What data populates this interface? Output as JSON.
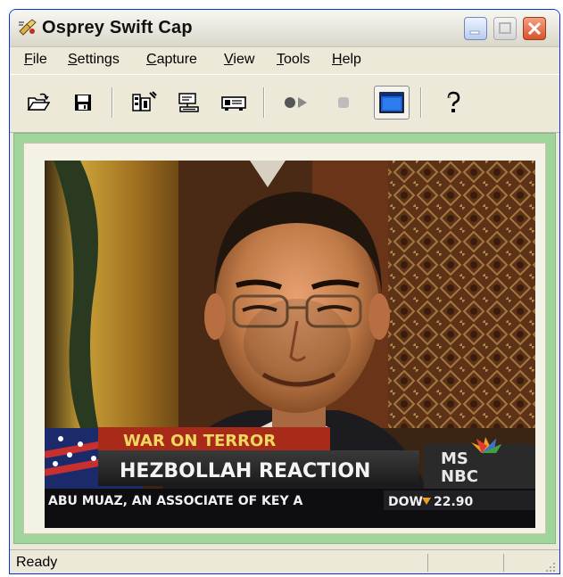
{
  "window": {
    "title": "Osprey Swift Cap"
  },
  "menu": {
    "items": [
      {
        "label": "File"
      },
      {
        "label": "Settings"
      },
      {
        "label": "Capture"
      },
      {
        "label": "View"
      },
      {
        "label": "Tools"
      },
      {
        "label": "Help"
      }
    ]
  },
  "toolbar": {
    "buttons": [
      {
        "icon": "open-folder-icon"
      },
      {
        "icon": "save-icon"
      },
      {
        "icon": "video-settings-icon"
      },
      {
        "icon": "capture-settings-icon"
      },
      {
        "icon": "device-icon"
      },
      {
        "icon": "record-icon"
      },
      {
        "icon": "stop-icon"
      },
      {
        "icon": "preview-window-icon"
      },
      {
        "icon": "help-icon"
      }
    ]
  },
  "video": {
    "lower_third_top": "WAR ON TERROR",
    "lower_third_main": "HEZBOLLAH REACTION",
    "ticker": "ABU MUAZ, AN ASSOCIATE OF KEY A",
    "dow_label": "DOW",
    "dow_value": "22.90",
    "network_line1": "MS",
    "network_line2": "NBC"
  },
  "status": {
    "text": "Ready"
  },
  "colors": {
    "accent": "#0831d9",
    "viewport_bg": "#9fd49a"
  }
}
